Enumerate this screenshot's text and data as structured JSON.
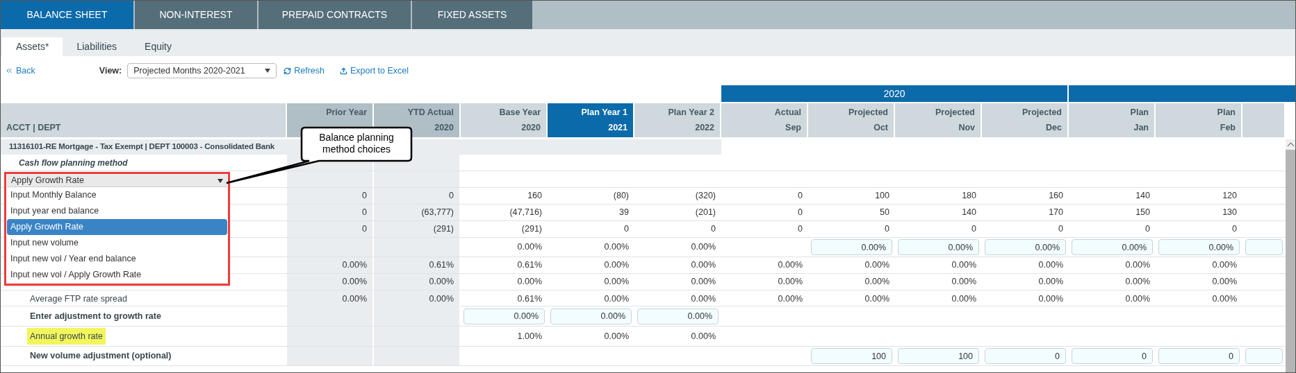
{
  "tabs": [
    {
      "label": "BALANCE SHEET",
      "selected": true
    },
    {
      "label": "NON-INTEREST",
      "selected": false
    },
    {
      "label": "PREPAID CONTRACTS",
      "selected": false
    },
    {
      "label": "FIXED ASSETS",
      "selected": false
    }
  ],
  "subtabs": [
    {
      "label": "Assets*",
      "selected": true
    },
    {
      "label": "Liabilities",
      "selected": false
    },
    {
      "label": "Equity",
      "selected": false
    }
  ],
  "toolbar": {
    "back": "Back",
    "view_label": "View:",
    "view_value": "Projected Months 2020-2021",
    "refresh": "Refresh",
    "export": "Export to Excel"
  },
  "year_band": "2020",
  "table": {
    "label_heading": "ACCT | DEPT",
    "columns": [
      {
        "title": "Prior Year",
        "highlighted": false,
        "shaded": true
      },
      {
        "title": "YTD Actual",
        "subtitle": "2020",
        "highlighted": false,
        "shaded": true
      },
      {
        "title": "Base Year",
        "subtitle": "2020",
        "highlighted": false,
        "shaded": false
      },
      {
        "title": "Plan Year 1",
        "subtitle": "2021",
        "highlighted": true,
        "shaded": false
      },
      {
        "title": "Plan Year 2",
        "subtitle": "2022",
        "highlighted": false,
        "shaded": false
      },
      {
        "title": "Actual",
        "subtitle": "Sep",
        "highlighted": false,
        "shaded": false
      },
      {
        "title": "Projected",
        "subtitle": "Oct",
        "highlighted": false,
        "shaded": false
      },
      {
        "title": "Projected",
        "subtitle": "Nov",
        "highlighted": false,
        "shaded": false
      },
      {
        "title": "Projected",
        "subtitle": "Dec",
        "highlighted": false,
        "shaded": false
      },
      {
        "title": "Plan",
        "subtitle": "Jan",
        "highlighted": false,
        "shaded": false
      },
      {
        "title": "Plan",
        "subtitle": "Feb",
        "highlighted": false,
        "shaded": false
      },
      {
        "highlighted": false,
        "shaded": false
      }
    ],
    "account": "11316101-RE Mortgage - Tax Exempt | DEPT 100003 - Consolidated Bank",
    "method_label": "Cash flow planning method",
    "method_dropdown": {
      "value": "Apply Growth Rate",
      "options": [
        {
          "label": "Input Monthly Balance",
          "selected": false
        },
        {
          "label": "Input year end balance",
          "selected": false
        },
        {
          "label": "Apply Growth Rate",
          "selected": true
        },
        {
          "label": "Input new volume",
          "selected": false
        },
        {
          "label": "Input new vol / Year end balance",
          "selected": false
        },
        {
          "label": "Input new vol / Apply Growth Rate",
          "selected": false
        }
      ]
    },
    "rows": [
      {
        "cells": [
          {
            "kind": "text",
            "value": "0"
          },
          {
            "kind": "text",
            "value": "0"
          },
          {
            "kind": "text",
            "value": "160"
          },
          {
            "kind": "text",
            "value": "(80)"
          },
          {
            "kind": "text",
            "value": "(320)"
          },
          {
            "kind": "text",
            "value": "0"
          },
          {
            "kind": "text",
            "value": "100"
          },
          {
            "kind": "text",
            "value": "180"
          },
          {
            "kind": "text",
            "value": "160"
          },
          {
            "kind": "text",
            "value": "140"
          },
          {
            "kind": "text",
            "value": "120"
          },
          {
            "kind": "blank"
          }
        ]
      },
      {
        "cells": [
          {
            "kind": "text",
            "value": "0"
          },
          {
            "kind": "text",
            "value": "(63,777)"
          },
          {
            "kind": "text",
            "value": "(47,716)"
          },
          {
            "kind": "text",
            "value": "39"
          },
          {
            "kind": "text",
            "value": "(201)"
          },
          {
            "kind": "text",
            "value": "0"
          },
          {
            "kind": "text",
            "value": "50"
          },
          {
            "kind": "text",
            "value": "140"
          },
          {
            "kind": "text",
            "value": "170"
          },
          {
            "kind": "text",
            "value": "150"
          },
          {
            "kind": "text",
            "value": "130"
          },
          {
            "kind": "blank"
          }
        ]
      },
      {
        "cells": [
          {
            "kind": "text",
            "value": "0"
          },
          {
            "kind": "text",
            "value": "(291)"
          },
          {
            "kind": "text",
            "value": "(291)"
          },
          {
            "kind": "text",
            "value": "0"
          },
          {
            "kind": "text",
            "value": "0"
          },
          {
            "kind": "text",
            "value": "0"
          },
          {
            "kind": "text",
            "value": "0"
          },
          {
            "kind": "text",
            "value": "0"
          },
          {
            "kind": "text",
            "value": "0"
          },
          {
            "kind": "text",
            "value": "0"
          },
          {
            "kind": "text",
            "value": "0"
          },
          {
            "kind": "blank"
          }
        ]
      },
      {
        "cells": [
          {
            "kind": "blank"
          },
          {
            "kind": "blank"
          },
          {
            "kind": "text",
            "value": "0.00%"
          },
          {
            "kind": "text",
            "value": "0.00%"
          },
          {
            "kind": "text",
            "value": "0.00%"
          },
          {
            "kind": "blank"
          },
          {
            "kind": "input",
            "value": "0.00%"
          },
          {
            "kind": "input",
            "value": "0.00%"
          },
          {
            "kind": "input",
            "value": "0.00%"
          },
          {
            "kind": "input",
            "value": "0.00%"
          },
          {
            "kind": "input",
            "value": "0.00%"
          },
          {
            "kind": "input"
          }
        ]
      },
      {
        "cells": [
          {
            "kind": "text",
            "value": "0.00%"
          },
          {
            "kind": "text",
            "value": "0.61%"
          },
          {
            "kind": "text",
            "value": "0.61%"
          },
          {
            "kind": "text",
            "value": "0.00%"
          },
          {
            "kind": "text",
            "value": "0.00%"
          },
          {
            "kind": "text",
            "value": "0.00%"
          },
          {
            "kind": "text",
            "value": "0.00%"
          },
          {
            "kind": "text",
            "value": "0.00%"
          },
          {
            "kind": "text",
            "value": "0.00%"
          },
          {
            "kind": "text",
            "value": "0.00%"
          },
          {
            "kind": "text",
            "value": "0.00%"
          },
          {
            "kind": "blank"
          }
        ]
      },
      {
        "cells": [
          {
            "kind": "text",
            "value": "0.00%"
          },
          {
            "kind": "text",
            "value": "0.00%"
          },
          {
            "kind": "text",
            "value": "0.00%"
          },
          {
            "kind": "text",
            "value": "0.00%"
          },
          {
            "kind": "text",
            "value": "0.00%"
          },
          {
            "kind": "text",
            "value": "0.00%"
          },
          {
            "kind": "text",
            "value": "0.00%"
          },
          {
            "kind": "text",
            "value": "0.00%"
          },
          {
            "kind": "text",
            "value": "0.00%"
          },
          {
            "kind": "text",
            "value": "0.00%"
          },
          {
            "kind": "text",
            "value": "0.00%"
          },
          {
            "kind": "blank"
          }
        ]
      },
      {
        "label": "Average FTP rate spread",
        "bold": false,
        "highlighted": false,
        "cells": [
          {
            "kind": "text",
            "value": "0.00%"
          },
          {
            "kind": "text",
            "value": "0.00%"
          },
          {
            "kind": "text",
            "value": "0.61%"
          },
          {
            "kind": "text",
            "value": "0.00%"
          },
          {
            "kind": "text",
            "value": "0.00%"
          },
          {
            "kind": "text",
            "value": "0.00%"
          },
          {
            "kind": "text",
            "value": "0.00%"
          },
          {
            "kind": "text",
            "value": "0.00%"
          },
          {
            "kind": "text",
            "value": "0.00%"
          },
          {
            "kind": "text",
            "value": "0.00%"
          },
          {
            "kind": "text",
            "value": "0.00%"
          },
          {
            "kind": "blank"
          }
        ]
      },
      {
        "label": "Enter adjustment to growth rate",
        "bold": true,
        "highlighted": false,
        "cells": [
          {
            "kind": "blank"
          },
          {
            "kind": "blank"
          },
          {
            "kind": "input",
            "value": "0.00%"
          },
          {
            "kind": "input",
            "value": "0.00%"
          },
          {
            "kind": "input",
            "value": "0.00%"
          },
          {
            "kind": "blank"
          },
          {
            "kind": "blank"
          },
          {
            "kind": "blank"
          },
          {
            "kind": "blank"
          },
          {
            "kind": "blank"
          },
          {
            "kind": "blank"
          },
          {
            "kind": "blank"
          }
        ]
      },
      {
        "label": "Annual growth rate",
        "bold": false,
        "highlighted": true,
        "cells": [
          {
            "kind": "blank"
          },
          {
            "kind": "blank"
          },
          {
            "kind": "text",
            "value": "1.00%"
          },
          {
            "kind": "text",
            "value": "0.00%"
          },
          {
            "kind": "text",
            "value": "0.00%"
          },
          {
            "kind": "blank"
          },
          {
            "kind": "blank"
          },
          {
            "kind": "blank"
          },
          {
            "kind": "blank"
          },
          {
            "kind": "blank"
          },
          {
            "kind": "blank"
          },
          {
            "kind": "blank"
          }
        ]
      },
      {
        "label": "New volume adjustment (optional)",
        "bold": true,
        "highlighted": false,
        "cells": [
          {
            "kind": "blank"
          },
          {
            "kind": "blank"
          },
          {
            "kind": "blank"
          },
          {
            "kind": "blank"
          },
          {
            "kind": "blank"
          },
          {
            "kind": "blank"
          },
          {
            "kind": "input",
            "value": "100"
          },
          {
            "kind": "input",
            "value": "100"
          },
          {
            "kind": "input",
            "value": "0"
          },
          {
            "kind": "input",
            "value": "0"
          },
          {
            "kind": "input",
            "value": "0"
          },
          {
            "kind": "input"
          }
        ]
      }
    ]
  },
  "callout": "Balance planning method choices"
}
